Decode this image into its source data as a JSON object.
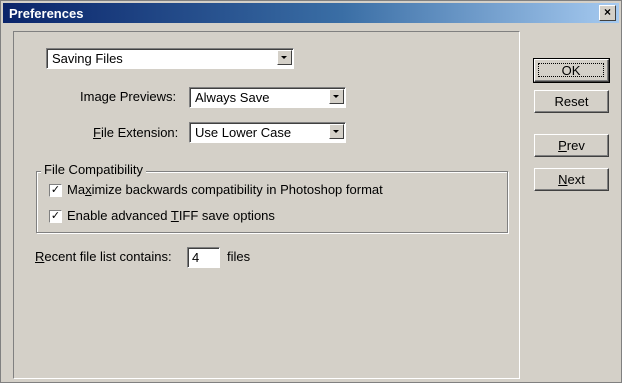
{
  "window": {
    "title": "Preferences",
    "close_glyph": "×"
  },
  "section_select": {
    "value": "Saving Files"
  },
  "image_previews": {
    "label_pre": "Ima",
    "label_u": "g",
    "label_post": "e Previews:",
    "value": "Always Save"
  },
  "file_extension": {
    "label_pre": "",
    "label_u": "F",
    "label_post": "ile Extension:",
    "value": "Use Lower Case"
  },
  "file_compat": {
    "title": "File Compatibility",
    "options": [
      {
        "checked": true,
        "check_glyph": "✓",
        "label_pre": "Ma",
        "label_u": "x",
        "label_post": "imize backwards compatibility in Photoshop format"
      },
      {
        "checked": true,
        "check_glyph": "✓",
        "label_pre": "Enable advanced ",
        "label_u": "T",
        "label_post": "IFF save options"
      }
    ]
  },
  "recent_files": {
    "label_u": "R",
    "label_post": "ecent file list contains:",
    "value": "4",
    "suffix": "files"
  },
  "buttons": {
    "ok": "OK",
    "reset": "Reset",
    "prev_u": "P",
    "prev_rest": "rev",
    "next_u": "N",
    "next_rest": "ext"
  }
}
